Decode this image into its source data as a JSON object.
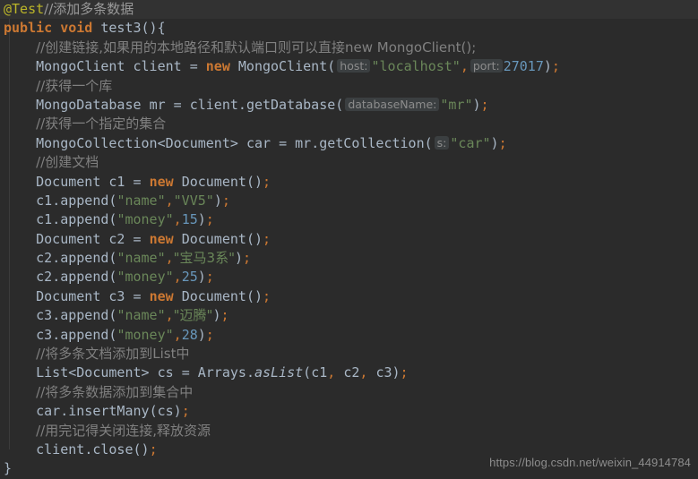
{
  "editor": {
    "theme": "darcula",
    "background": "#2b2b2b",
    "current_line_background": "#323232",
    "default_text_color": "#a9b7c6",
    "language": "Java",
    "font_size_px": 15,
    "line_height_px": 21.4,
    "colors": {
      "keyword": "#cc7832",
      "annotation": "#bbb529",
      "comment": "#808080",
      "string": "#6a8759",
      "number": "#6897bb",
      "identifier": "#a9b7c6",
      "hint_background": "#3b3f41",
      "hint_text": "#8c8c8c",
      "indent_guide": "#3b3b3b",
      "watermark": "#8d8d8d"
    }
  },
  "code": {
    "line01": {
      "annotation": "@Test",
      "comment": "//添加多条数据"
    },
    "line02": {
      "kw_public": "public",
      "kw_void": "void",
      "method": "test3",
      "parens": "()",
      "brace": "{"
    },
    "line03": {
      "comment": "//创建链接,如果用的本地路径和默认端口则可以直接new MongoClient();"
    },
    "line04": {
      "type": "MongoClient",
      "var": "client",
      "assign": "=",
      "kw_new": "new",
      "ctor": "MongoClient",
      "open": "(",
      "hint_host": "host:",
      "str_host": "\"localhost\"",
      "comma": ",",
      "hint_port": "port:",
      "num_port": "27017",
      "close": ")",
      "semi": ";"
    },
    "line05": {
      "comment": "//获得一个库"
    },
    "line06": {
      "type": "MongoDatabase",
      "var": "mr",
      "assign": "=",
      "recv": "client",
      "dot": ".",
      "method": "getDatabase",
      "open": "(",
      "hint_dbname": "databaseName:",
      "str_db": "\"mr\"",
      "close": ")",
      "semi": ";"
    },
    "line07": {
      "comment": "//获得一个指定的集合"
    },
    "line08": {
      "type": "MongoCollection<Document>",
      "var": "car",
      "assign": "=",
      "recv": "mr",
      "dot": ".",
      "method": "getCollection",
      "open": "(",
      "hint_s": "s:",
      "str_car": "\"car\"",
      "close": ")",
      "semi": ";"
    },
    "line09": {
      "comment": "//创建文档"
    },
    "line10": {
      "type": "Document",
      "var": "c1",
      "assign": "=",
      "kw_new": "new",
      "ctor": "Document",
      "parens": "()",
      "semi": ";"
    },
    "line11": {
      "recv": "c1",
      "dot": ".",
      "method": "append",
      "open": "(",
      "str_key": "\"name\"",
      "comma": ",",
      "str_val": "\"VV5\"",
      "close": ")",
      "semi": ";"
    },
    "line12": {
      "recv": "c1",
      "dot": ".",
      "method": "append",
      "open": "(",
      "str_key": "\"money\"",
      "comma": ",",
      "num_val": "15",
      "close": ")",
      "semi": ";"
    },
    "line13": {
      "type": "Document",
      "var": "c2",
      "assign": "=",
      "kw_new": "new",
      "ctor": "Document",
      "parens": "()",
      "semi": ";"
    },
    "line14": {
      "recv": "c2",
      "dot": ".",
      "method": "append",
      "open": "(",
      "str_key": "\"name\"",
      "comma": ",",
      "str_val": "\"宝马3系\"",
      "close": ")",
      "semi": ";"
    },
    "line15": {
      "recv": "c2",
      "dot": ".",
      "method": "append",
      "open": "(",
      "str_key": "\"money\"",
      "comma": ",",
      "num_val": "25",
      "close": ")",
      "semi": ";"
    },
    "line16": {
      "type": "Document",
      "var": "c3",
      "assign": "=",
      "kw_new": "new",
      "ctor": "Document",
      "parens": "()",
      "semi": ";"
    },
    "line17": {
      "recv": "c3",
      "dot": ".",
      "method": "append",
      "open": "(",
      "str_key": "\"name\"",
      "comma": ",",
      "str_val": "\"迈腾\"",
      "close": ")",
      "semi": ";"
    },
    "line18": {
      "recv": "c3",
      "dot": ".",
      "method": "append",
      "open": "(",
      "str_key": "\"money\"",
      "comma": ",",
      "num_val": "28",
      "close": ")",
      "semi": ";"
    },
    "line19": {
      "comment": "//将多条文档添加到List中"
    },
    "line20": {
      "type": "List<Document>",
      "var": "cs",
      "assign": "=",
      "recv": "Arrays",
      "dot": ".",
      "method": "asList",
      "open": "(",
      "arg1": "c1",
      "comma1": ",",
      "arg2": "c2",
      "comma2": ",",
      "arg3": "c3",
      "close": ")",
      "semi": ";"
    },
    "line21": {
      "comment": "//将多条数据添加到集合中"
    },
    "line22": {
      "recv": "car",
      "dot": ".",
      "method": "insertMany",
      "open": "(",
      "arg": "cs",
      "close": ")",
      "semi": ";"
    },
    "line23": {
      "comment": "//用完记得关闭连接,释放资源"
    },
    "line24": {
      "recv": "client",
      "dot": ".",
      "method": "close",
      "parens": "()",
      "semi": ";"
    },
    "line25": {
      "brace": "}"
    }
  },
  "watermark": {
    "text": "https://blog.csdn.net/weixin_44914784"
  }
}
